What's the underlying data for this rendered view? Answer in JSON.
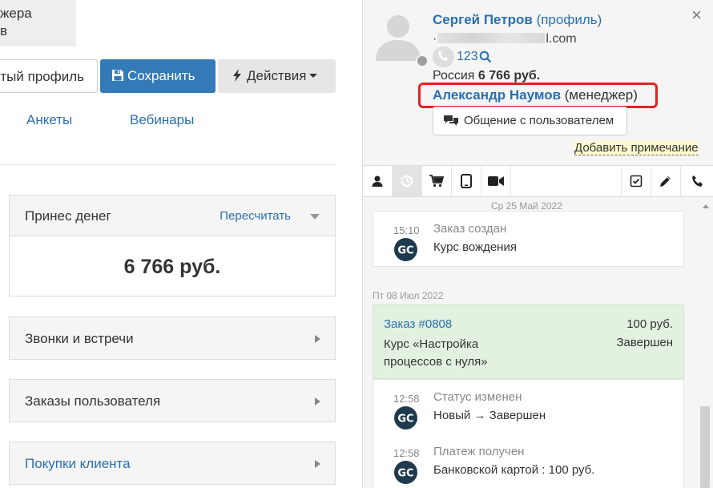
{
  "left": {
    "note_lines": [
      "жера",
      "в"
    ],
    "buttons": {
      "open_profile": "тый профиль",
      "save": "Сохранить",
      "actions": "Действия"
    },
    "tabs": [
      "Анкеты",
      "Вебинары"
    ],
    "money_panel": {
      "title": "Принес денег",
      "recalc": "Пересчитать",
      "amount": "6 766 руб."
    },
    "panels": {
      "calls": "Звонки и встречи",
      "orders": "Заказы пользователя",
      "purchases": "Покупки клиента"
    }
  },
  "right": {
    "user": {
      "name": "Сергей Петров",
      "profile_link": "(профиль)",
      "email_prefix": "",
      "email_suffix": "l.com",
      "phone": "123",
      "country": "Россия",
      "total": "6 766 руб."
    },
    "manager": {
      "name": "Александр Наумов",
      "role": "(менеджер)"
    },
    "chat_button": "Общение с пользователем",
    "add_note": "Добавить примечание",
    "feed": {
      "date1": "Ср 25 Май 2022",
      "event1": {
        "time": "15:10",
        "title": "Заказ создан",
        "text": "Курс вождения"
      },
      "date2": "Пт 08 Июл 2022",
      "order": {
        "title": "Заказ #0808",
        "price": "100 руб.",
        "desc_line1": "Курс «Настройка",
        "desc_line2": "процессов с нуля»",
        "status": "Завершен"
      },
      "event2": {
        "time": "12:58",
        "title": "Статус изменен",
        "text": "Новый → Завершен"
      },
      "event3": {
        "time": "12:58",
        "title": "Платеж получен",
        "text": "Банковской картой : 100 руб."
      },
      "gc_label": "GC"
    }
  },
  "colors": {
    "link": "#2a6fb0",
    "primary": "#337ab7",
    "highlight": "#e02424",
    "order_bg": "#e2f1e0"
  }
}
